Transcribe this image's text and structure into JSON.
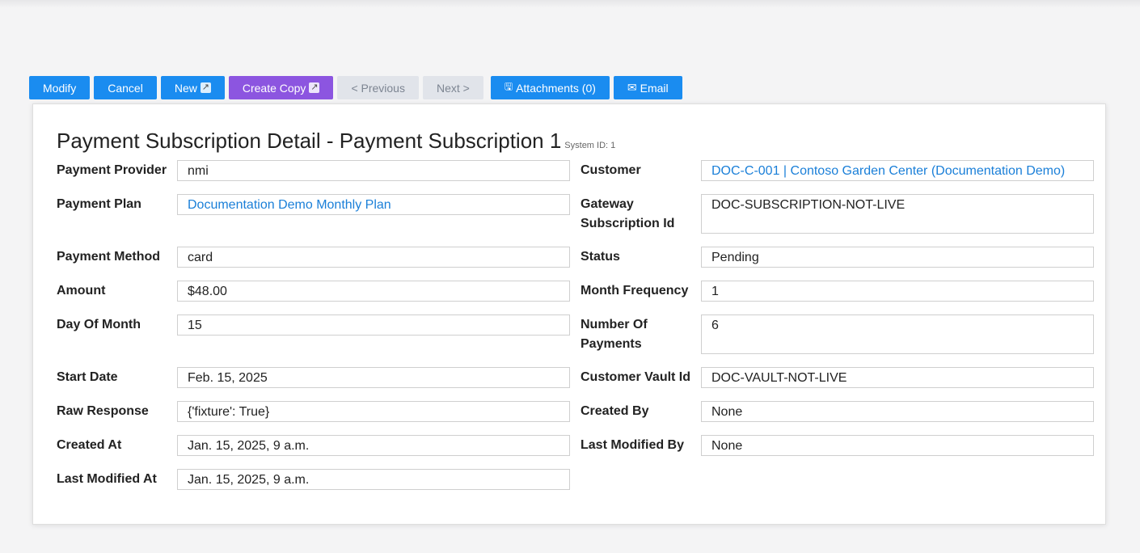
{
  "toolbar": {
    "modify": "Modify",
    "cancel": "Cancel",
    "new": "New",
    "create_copy": "Create Copy",
    "previous": "< Previous",
    "next": "Next >",
    "attachments": "Attachments (0)",
    "email": "Email",
    "ext_glyph": "↗",
    "save_glyph": "🖫",
    "mail_glyph": "✉"
  },
  "page": {
    "title": "Payment Subscription Detail - Payment Subscription 1",
    "system_id": "System ID: 1"
  },
  "fields": {
    "payment_provider": {
      "label": "Payment Provider",
      "value": "nmi"
    },
    "customer": {
      "label": "Customer",
      "value": "DOC-C-001 | Contoso Garden Center (Documentation Demo)"
    },
    "payment_plan": {
      "label": "Payment Plan",
      "value": "Documentation Demo Monthly Plan"
    },
    "gateway_subscription_id": {
      "label": "Gateway Subscription Id",
      "value": "DOC-SUBSCRIPTION-NOT-LIVE"
    },
    "payment_method": {
      "label": "Payment Method",
      "value": "card"
    },
    "status": {
      "label": "Status",
      "value": "Pending"
    },
    "amount": {
      "label": "Amount",
      "value": "$48.00"
    },
    "month_frequency": {
      "label": "Month Frequency",
      "value": "1"
    },
    "day_of_month": {
      "label": "Day Of Month",
      "value": "15"
    },
    "number_of_payments": {
      "label": "Number Of Payments",
      "value": "6"
    },
    "start_date": {
      "label": "Start Date",
      "value": "Feb. 15, 2025"
    },
    "customer_vault_id": {
      "label": "Customer Vault Id",
      "value": "DOC-VAULT-NOT-LIVE"
    },
    "raw_response": {
      "label": "Raw Response",
      "value": "{'fixture': True}"
    },
    "created_by": {
      "label": "Created By",
      "value": "None"
    },
    "created_at": {
      "label": "Created At",
      "value": "Jan. 15, 2025, 9 a.m."
    },
    "last_modified_by": {
      "label": "Last Modified By",
      "value": "None"
    },
    "last_modified_at": {
      "label": "Last Modified At",
      "value": "Jan. 15, 2025, 9 a.m."
    }
  },
  "colors": {
    "primary": "#1a8cf0",
    "purple": "#8c55e0",
    "disabled": "#e1e4ea",
    "link": "#1a7fd8"
  }
}
